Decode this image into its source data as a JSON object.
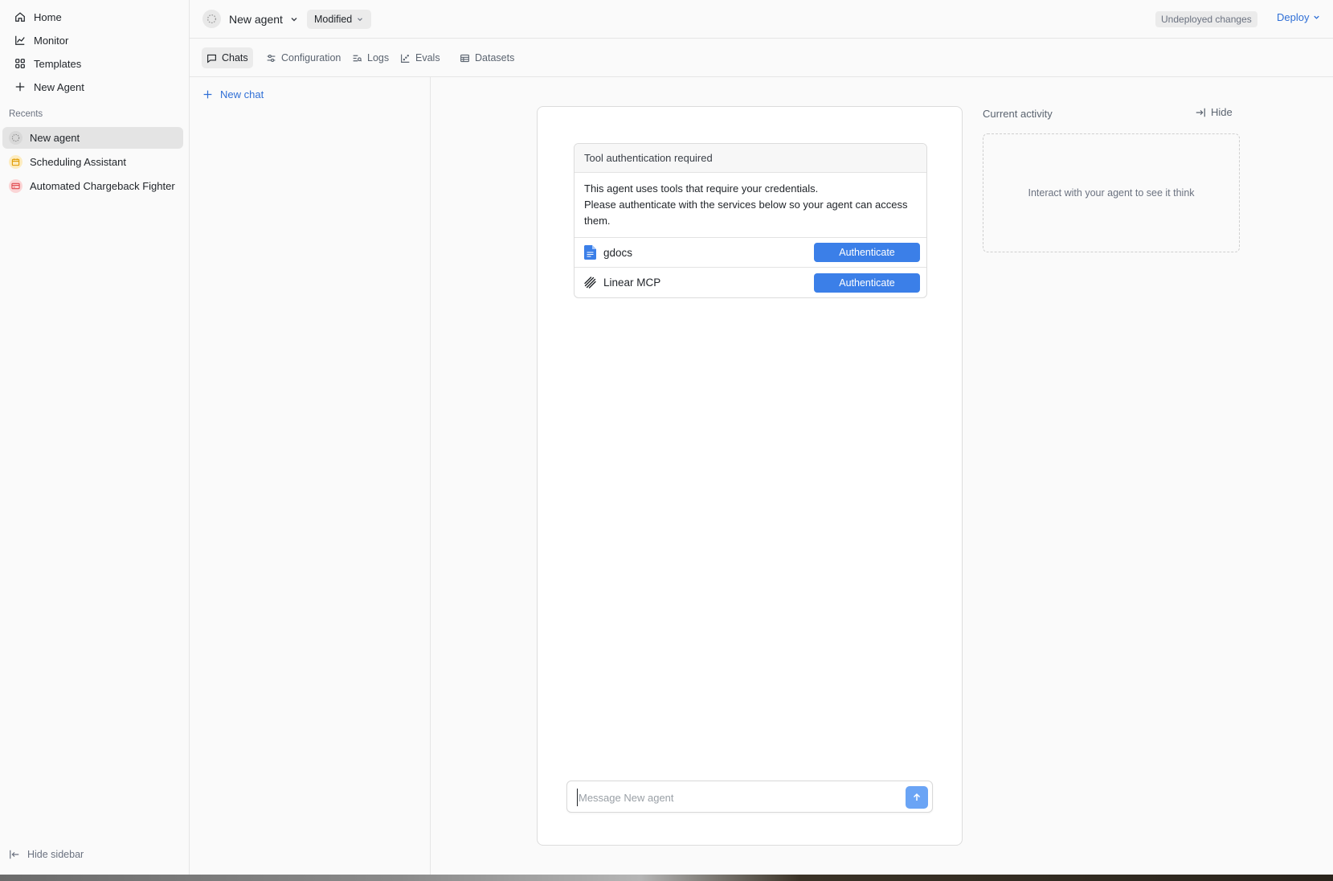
{
  "sidebar": {
    "nav": [
      {
        "label": "Home",
        "icon": "home-icon"
      },
      {
        "label": "Monitor",
        "icon": "chart-line-icon"
      },
      {
        "label": "Templates",
        "icon": "grid-icon"
      },
      {
        "label": "New Agent",
        "icon": "plus-icon"
      }
    ],
    "recents_label": "Recents",
    "recents": [
      {
        "label": "New agent",
        "icon": "agent-dots-icon",
        "active": true
      },
      {
        "label": "Scheduling Assistant",
        "icon": "calendar-icon",
        "color": "#f5b400"
      },
      {
        "label": "Automated Chargeback Fighter",
        "icon": "credit-card-icon",
        "color": "#e0474c"
      }
    ],
    "hide_label": "Hide sidebar"
  },
  "topbar": {
    "agent_name": "New agent",
    "version_label": "Modified",
    "undeployed_label": "Undeployed changes",
    "deploy_label": "Deploy"
  },
  "tabs": [
    {
      "label": "Chats",
      "icon": "chat-icon",
      "active": true
    },
    {
      "label": "Configuration",
      "icon": "sliders-icon"
    },
    {
      "label": "Logs",
      "icon": "logs-icon"
    },
    {
      "label": "Evals",
      "icon": "scatter-icon"
    },
    {
      "label": "Datasets",
      "icon": "table-icon"
    }
  ],
  "chatlist": {
    "new_chat_label": "New chat"
  },
  "auth": {
    "title": "Tool authentication required",
    "line1": "This agent uses tools that require your credentials.",
    "line2": "Please authenticate with the services below so your agent can access them.",
    "tools": [
      {
        "name": "gdocs",
        "icon": "google-docs-icon",
        "button": "Authenticate"
      },
      {
        "name": "Linear MCP",
        "icon": "linear-icon",
        "button": "Authenticate"
      }
    ]
  },
  "composer": {
    "placeholder": "Message New agent",
    "value": ""
  },
  "activity": {
    "title": "Current activity",
    "hide_label": "Hide",
    "empty_text": "Interact with your agent to see it think"
  },
  "colors": {
    "accent": "#3b7fe8",
    "link": "#2f6fd6"
  }
}
